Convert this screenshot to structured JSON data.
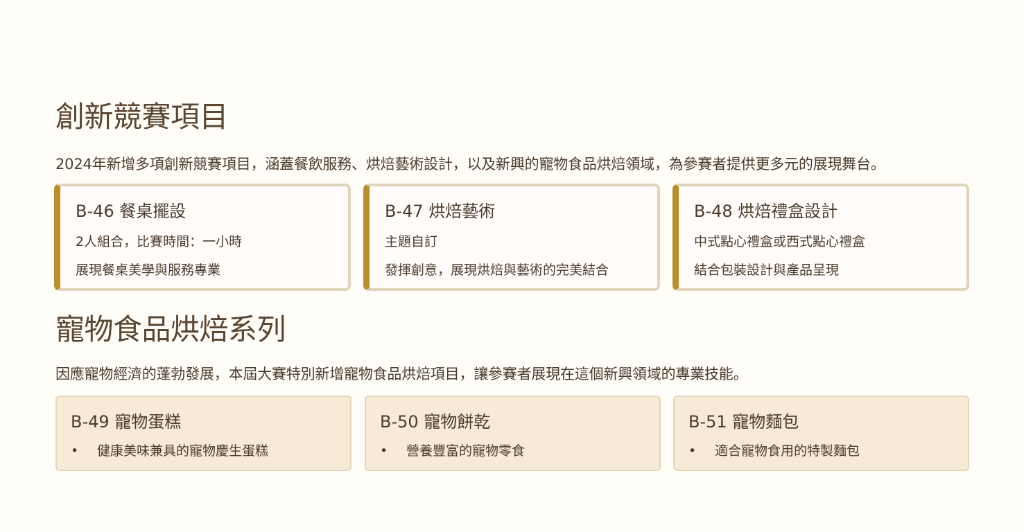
{
  "innovation": {
    "title": "創新競賽項目",
    "description": "2024年新增多項創新競賽項目，涵蓋餐飲服務、烘焙藝術設計，以及新興的寵物食品烘焙領域，為參賽者提供更多元的展現舞台。",
    "cards": [
      {
        "title": "B-46 餐桌擺設",
        "line1": "2人組合，比賽時間：一小時",
        "line2": "展現餐桌美學與服務專業"
      },
      {
        "title": "B-47 烘焙藝術",
        "line1": "主題自訂",
        "line2": "發揮創意，展現烘焙與藝術的完美結合"
      },
      {
        "title": "B-48 烘焙禮盒設計",
        "line1": "中式點心禮盒或西式點心禮盒",
        "line2": "結合包裝設計與產品呈現"
      }
    ]
  },
  "pet": {
    "title": "寵物食品烘焙系列",
    "description": "因應寵物經濟的蓬勃發展，本屆大賽特別新增寵物食品烘焙項目，讓參賽者展現在這個新興領域的專業技能。",
    "cards": [
      {
        "title": "B-49 寵物蛋糕",
        "bullet": "健康美味兼具的寵物慶生蛋糕"
      },
      {
        "title": "B-50 寵物餅乾",
        "bullet": "營養豐富的寵物零食"
      },
      {
        "title": "B-51 寵物麵包",
        "bullet": "適合寵物食用的特製麵包"
      }
    ]
  },
  "colors": {
    "accent": "#b98f2a",
    "innov_border": "#e0d4bd",
    "pet_card_bg": "#f7ead6",
    "page_bg": "#fffdf8",
    "text": "#4a3b2d"
  }
}
